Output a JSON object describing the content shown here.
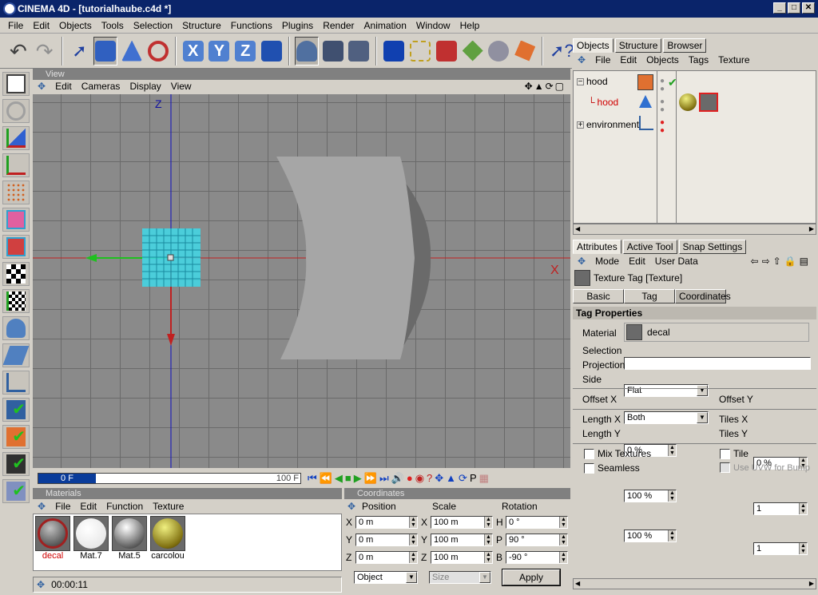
{
  "window": {
    "title": "CINEMA 4D - [tutorialhaube.c4d *]",
    "min": "_",
    "max": "□",
    "close": "✕"
  },
  "menu": [
    "File",
    "Edit",
    "Objects",
    "Tools",
    "Selection",
    "Structure",
    "Functions",
    "Plugins",
    "Render",
    "Animation",
    "Window",
    "Help"
  ],
  "toolbar": {
    "axis_x": "X",
    "axis_y": "Y",
    "axis_z": "Z"
  },
  "view": {
    "header": "View",
    "menu": [
      "Edit",
      "Cameras",
      "Display",
      "View"
    ],
    "axis_z": "Z",
    "axis_x": "X"
  },
  "timeline": {
    "frame": "0 F",
    "end": "100 F"
  },
  "materials": {
    "header": "Materials",
    "menu": [
      "File",
      "Edit",
      "Function",
      "Texture"
    ],
    "items": [
      {
        "name": "decal",
        "color": "#d00000"
      },
      {
        "name": "Mat.7",
        "color": "#000000"
      },
      {
        "name": "Mat.5",
        "color": "#000000"
      },
      {
        "name": "carcolou",
        "color": "#000000"
      }
    ],
    "status": "00:00:11"
  },
  "coordinates": {
    "header": "Coordinates",
    "cols": [
      "Position",
      "Scale",
      "Rotation"
    ],
    "rows": [
      {
        "a": "X",
        "pos": "0 m",
        "b": "X",
        "scale": "100 m",
        "c": "H",
        "rot": "0 °"
      },
      {
        "a": "Y",
        "pos": "0 m",
        "b": "Y",
        "scale": "100 m",
        "c": "P",
        "rot": "90 °"
      },
      {
        "a": "Z",
        "pos": "0 m",
        "b": "Z",
        "scale": "100 m",
        "c": "B",
        "rot": "-90 °"
      }
    ],
    "mode": "Object",
    "size": "Size",
    "apply": "Apply"
  },
  "objects": {
    "tabs": [
      "Objects",
      "Structure",
      "Browser"
    ],
    "menu": [
      "File",
      "Edit",
      "Objects",
      "Tags",
      "Texture"
    ],
    "tree": [
      {
        "name": "hood",
        "color": "#000000"
      },
      {
        "name": "hood",
        "color": "#d00000"
      },
      {
        "name": "environment",
        "color": "#000000"
      }
    ]
  },
  "attributes": {
    "tabs": [
      "Attributes",
      "Active Tool",
      "Snap Settings"
    ],
    "menu": [
      "Mode",
      "Edit",
      "User Data"
    ],
    "title": "Texture Tag [Texture]",
    "subtabs": [
      "Basic",
      "Tag",
      "Coordinates"
    ],
    "section": "Tag Properties",
    "material_label": "Material",
    "material": "decal",
    "selection_label": "Selection",
    "selection": "",
    "projection_label": "Projection",
    "projection": "Flat",
    "side_label": "Side",
    "side": "Both",
    "offsetx_label": "Offset X",
    "offsetx": "0 %",
    "offsety_label": "Offset Y",
    "offsety": "0 %",
    "lengthx_label": "Length X",
    "lengthx": "100 %",
    "lengthy_label": "Length Y",
    "lengthy": "100 %",
    "tilesx_label": "Tiles X",
    "tilesx": "1",
    "tilesy_label": "Tiles Y",
    "tilesy": "1",
    "mix_label": "Mix Textures",
    "seamless_label": "Seamless",
    "tile_label": "Tile",
    "uvw_label": "Use UVW for Bump"
  }
}
